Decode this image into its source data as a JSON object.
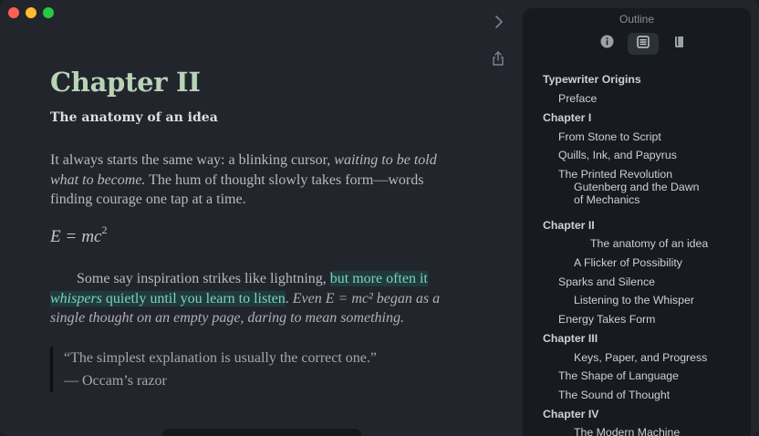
{
  "editor": {
    "chapter_title": "Chapter II",
    "subtitle": "The anatomy of an idea",
    "p1_a": "It always starts the same way: a blinking cursor, ",
    "p1_b": "waiting to be told what to become.",
    "p1_c": " The hum of thought slowly takes form—words finding courage one tap at a time.",
    "eq_lhs": "E",
    "eq_sign": "=",
    "eq_rhs": "mc",
    "eq_exp": "2",
    "p2_a": "Some say inspiration strikes like lightning, ",
    "p2_hl1": "but more often it ",
    "p2_hl2": "whispers",
    "p2_hl3": " quietly until you learn to listen",
    "p2_b": ". ",
    "p2_c": "Even E = mc² began as a single thought on an empty page, daring to mean something.",
    "quote_text": "“The simplest explanation is usually the correct one.”",
    "quote_author": "—  Occam’s razor"
  },
  "sidebar": {
    "title": "Outline",
    "tabs": [
      {
        "icon": "info-icon"
      },
      {
        "icon": "outline-list-icon"
      },
      {
        "icon": "book-icon"
      }
    ],
    "items": [
      {
        "label": "Typewriter Origins",
        "level": 0,
        "bold": true
      },
      {
        "label": "Preface",
        "level": 1,
        "bold": false
      },
      {
        "label": "Chapter I",
        "level": 0,
        "bold": true
      },
      {
        "label": "From Stone to Script",
        "level": 1,
        "bold": false
      },
      {
        "label": "Quills, Ink, and Papyrus",
        "level": 1,
        "bold": false
      },
      {
        "label": "The Printed Revolution",
        "level": 1,
        "bold": false
      },
      {
        "label": "Gutenberg and the Dawn of Mechanics",
        "level": 2,
        "bold": false
      },
      {
        "label": "Chapter II",
        "level": 0,
        "bold": true
      },
      {
        "label": "The anatomy of an idea",
        "level": 3,
        "bold": false
      },
      {
        "label": "A Flicker of Possibility",
        "level": 2,
        "bold": false
      },
      {
        "label": "Sparks and Silence",
        "level": 1,
        "bold": false
      },
      {
        "label": "Listening to the Whisper",
        "level": 2,
        "bold": false
      },
      {
        "label": "Energy Takes Form",
        "level": 1,
        "bold": false
      },
      {
        "label": "Chapter III",
        "level": 0,
        "bold": true
      },
      {
        "label": "Keys, Paper, and Progress",
        "level": 2,
        "bold": false
      },
      {
        "label": "The Shape of Language",
        "level": 1,
        "bold": false
      },
      {
        "label": "The Sound of Thought",
        "level": 1,
        "bold": false
      },
      {
        "label": "Chapter IV",
        "level": 0,
        "bold": true
      },
      {
        "label": "The Modern Machine",
        "level": 2,
        "bold": false
      }
    ]
  },
  "colors": {
    "heading": "#b9d3b8",
    "highlight_bg": "#1f3b3b",
    "highlight_text": "#7fd0c2"
  }
}
